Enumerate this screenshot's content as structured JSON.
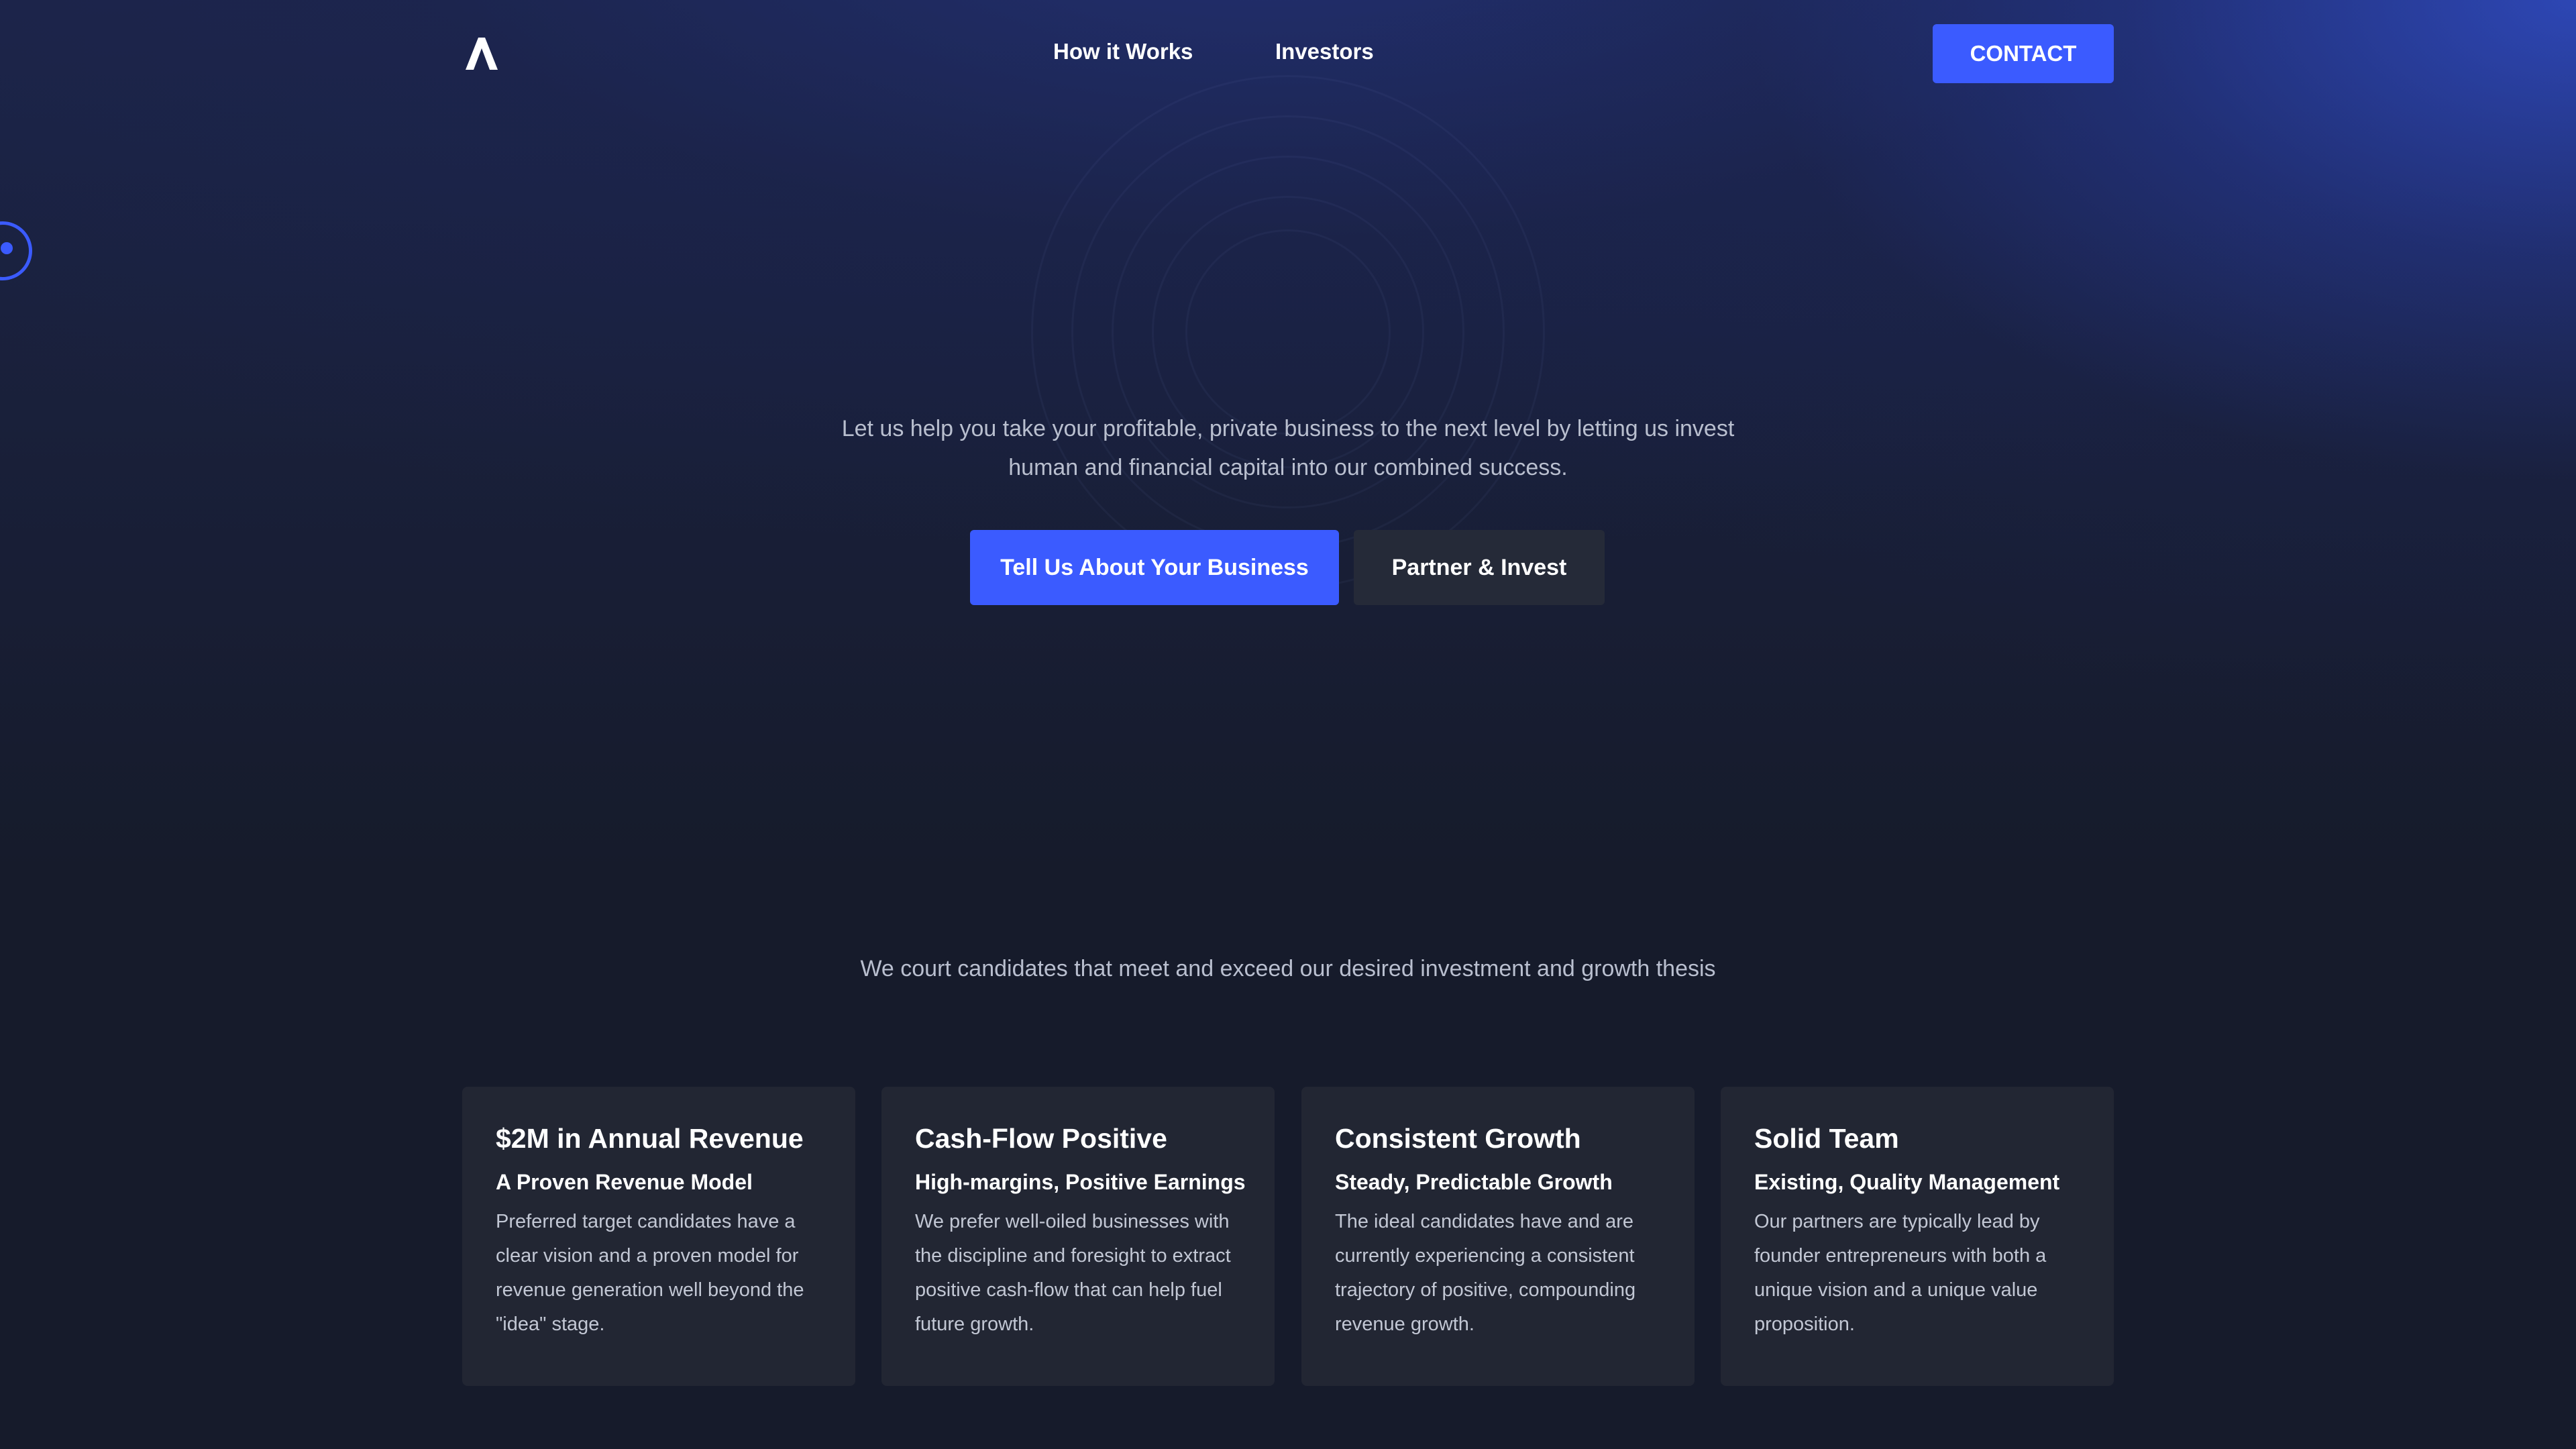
{
  "header": {
    "logo_icon": "a-chevron-logo-icon",
    "nav": [
      {
        "label": "How it Works"
      },
      {
        "label": "Investors"
      }
    ],
    "contact_label": "CONTACT"
  },
  "hero": {
    "text": "Let us help you take your profitable, private business to the next level by letting us invest human and financial capital into our combined success.",
    "primary_button": "Tell Us About Your Business",
    "secondary_button": "Partner & Invest"
  },
  "thesis": {
    "text": "We court candidates that meet and exceed our desired investment and growth thesis"
  },
  "cards": [
    {
      "title": "$2M in Annual Revenue",
      "subtitle": "A Proven Revenue Model",
      "body": "Preferred target candidates have a clear vision and a proven model for revenue generation well beyond the \"idea\" stage."
    },
    {
      "title": "Cash-Flow Positive",
      "subtitle": "High-margins, Positive Earnings",
      "body": "We prefer well-oiled businesses with the discipline and foresight to extract positive cash-flow that can help fuel future growth."
    },
    {
      "title": "Consistent Growth",
      "subtitle": "Steady, Predictable Growth",
      "body": "The ideal candidates have and are currently experiencing a consistent trajectory of positive, compounding revenue growth."
    },
    {
      "title": "Solid Team",
      "subtitle": "Existing, Quality Management",
      "body": "Our partners are typically lead by founder entrepreneurs with both a unique vision and a unique value proposition."
    }
  ],
  "colors": {
    "accent": "#3b5bff",
    "background": "#161b2b",
    "card": "#222633",
    "secondary_button": "#252a38",
    "muted_text": "#b9bfcf"
  }
}
